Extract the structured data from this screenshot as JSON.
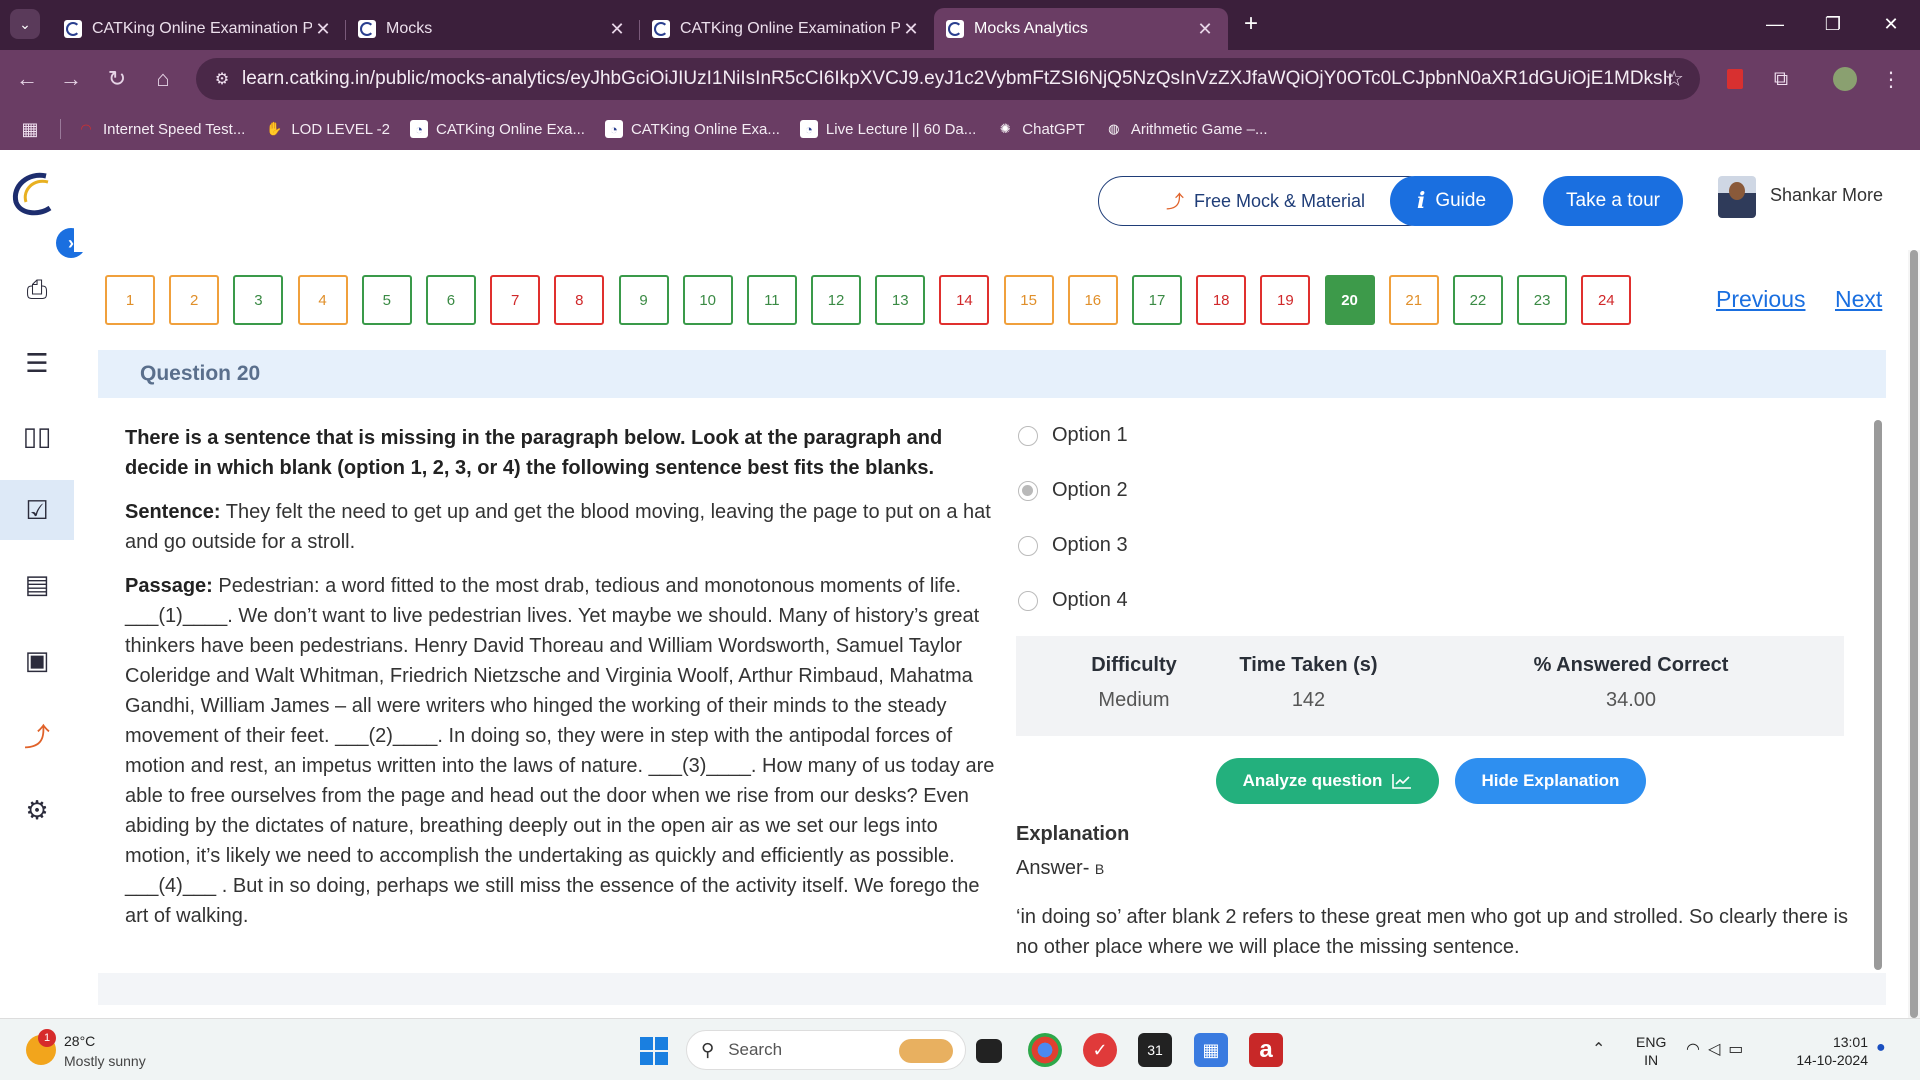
{
  "browser": {
    "tabs": [
      {
        "title": "CATKing Online Examination Pla",
        "active": false
      },
      {
        "title": "Mocks",
        "active": false
      },
      {
        "title": "CATKing Online Examination Pla",
        "active": false
      },
      {
        "title": "Mocks Analytics",
        "active": true
      }
    ],
    "url": "learn.catking.in/public/mocks-analytics/eyJhbGciOiJIUzI1NiIsInR5cCI6IkpXVCJ9.eyJ1c2VybmFtZSI6NjQ5NzQsInVzZXJfaWQiOjY0OTc0LCJpbnN0aXR1dGUiOjE1MDksImlkIjo2NDk3NC...",
    "bookmarks": [
      {
        "label": "Internet Speed Test...",
        "icon": "speedometer-icon"
      },
      {
        "label": "LOD LEVEL -2",
        "icon": "hand-icon"
      },
      {
        "label": "CATKing Online Exa...",
        "icon": "catking-icon"
      },
      {
        "label": "CATKing Online Exa...",
        "icon": "catking-icon"
      },
      {
        "label": "Live Lecture || 60 Da...",
        "icon": "catking-icon"
      },
      {
        "label": "ChatGPT",
        "icon": "chatgpt-icon"
      },
      {
        "label": "Arithmetic Game –...",
        "icon": "globe-icon"
      }
    ]
  },
  "header": {
    "free_mock_label": "Free Mock & Material",
    "guide_label": "Guide",
    "tour_label": "Take a tour",
    "user_name": "Shankar More"
  },
  "question_nav": {
    "items": [
      {
        "n": "1",
        "status": "orange"
      },
      {
        "n": "2",
        "status": "orange"
      },
      {
        "n": "3",
        "status": "green"
      },
      {
        "n": "4",
        "status": "orange"
      },
      {
        "n": "5",
        "status": "green"
      },
      {
        "n": "6",
        "status": "green"
      },
      {
        "n": "7",
        "status": "red"
      },
      {
        "n": "8",
        "status": "red"
      },
      {
        "n": "9",
        "status": "green"
      },
      {
        "n": "10",
        "status": "green"
      },
      {
        "n": "11",
        "status": "green"
      },
      {
        "n": "12",
        "status": "green"
      },
      {
        "n": "13",
        "status": "green"
      },
      {
        "n": "14",
        "status": "red"
      },
      {
        "n": "15",
        "status": "orange"
      },
      {
        "n": "16",
        "status": "orange"
      },
      {
        "n": "17",
        "status": "green"
      },
      {
        "n": "18",
        "status": "red"
      },
      {
        "n": "19",
        "status": "red"
      },
      {
        "n": "20",
        "status": "current"
      },
      {
        "n": "21",
        "status": "orange"
      },
      {
        "n": "22",
        "status": "green"
      },
      {
        "n": "23",
        "status": "green"
      },
      {
        "n": "24",
        "status": "red"
      }
    ],
    "previous_label": "Previous",
    "next_label": "Next"
  },
  "question": {
    "header": "Question 20",
    "instruction": "There is a sentence that is missing in the paragraph below. Look at the paragraph and decide in which blank (option 1, 2, 3, or 4) the following sentence best fits the blanks.",
    "sentence_label": "Sentence:",
    "sentence": " They felt the need to get up and get the blood moving, leaving the page to put on a hat and go outside for a stroll.",
    "passage_label": "Passage:",
    "passage": " Pedestrian: a word fitted to the most drab, tedious and monotonous moments of life. ___(1)____.  We don’t want to live pedestrian lives. Yet maybe we should. Many of history’s great thinkers have been pedestrians. Henry David Thoreau and William Wordsworth, Samuel Taylor Coleridge and Walt Whitman, Friedrich Nietzsche and Virginia Woolf, Arthur Rimbaud, Mahatma Gandhi, William James – all were writers who hinged the working of their minds to the steady movement of their feet. ___(2)____.  In doing so, they were in step with the antipodal forces of motion and rest, an impetus written into the laws of nature. ___(3)____.  How many of us today are able to free ourselves from the page and head out the door when we rise from our desks? Even abiding by the dictates of nature, breathing deeply out in the open air as we set our legs into motion, it’s likely we need to accomplish the undertaking as quickly and efficiently as possible. ___(4)___ .  But in so doing, perhaps we still miss the essence of the activity itself. We forego the art of walking.",
    "options": [
      {
        "label": "Option 1",
        "selected": false
      },
      {
        "label": "Option 2",
        "selected": true
      },
      {
        "label": "Option 3",
        "selected": false
      },
      {
        "label": "Option 4",
        "selected": false
      }
    ]
  },
  "stats": {
    "difficulty_label": "Difficulty",
    "difficulty_value": "Medium",
    "time_label": "Time Taken (s)",
    "time_value": "142",
    "correct_label": "% Answered Correct",
    "correct_value": "34.00"
  },
  "actions": {
    "analyze_label": "Analyze question",
    "hide_label": "Hide Explanation"
  },
  "explanation": {
    "title": "Explanation",
    "answer_prefix": "Answer- ",
    "answer_value": "B",
    "text": "‘in doing so’ after blank 2 refers to these great men who got up and strolled.  So clearly there is no other place where we will place the missing sentence."
  },
  "taskbar": {
    "weather_badge": "1",
    "temperature": "28°C",
    "weather": "Mostly sunny",
    "search_label": "Search",
    "lang_top": "ENG",
    "lang_bottom": "IN",
    "time": "13:01",
    "date": "14-10-2024"
  },
  "colors": {
    "primary_blue": "#1a6fe0",
    "answered_green": "#3a9a4a",
    "wrong_red": "#e0302e",
    "skipped_orange": "#f0a03c",
    "analyze_green": "#23b07d"
  }
}
